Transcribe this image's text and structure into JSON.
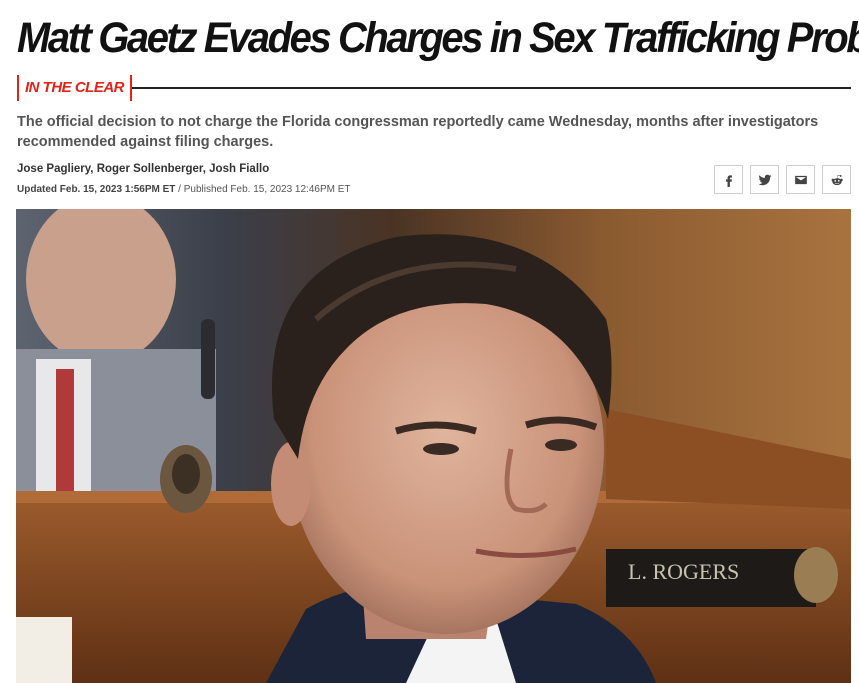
{
  "article": {
    "headline": "Matt Gaetz Evades Charges in Sex Trafficking Probe",
    "rubric": "IN THE CLEAR",
    "dek": "The official decision to not charge the Florida congressman reportedly came Wednesday, months after investigators recommended against filing charges.",
    "authors": "Jose Pagliery, Roger Sollenberger, Josh Fiallo",
    "updated": "Updated Feb. 15, 2023 1:56PM ET",
    "published_sep": " / ",
    "published": "Published Feb. 15, 2023 12:46PM ET"
  },
  "share": {
    "icons": [
      "facebook-icon",
      "twitter-icon",
      "email-icon",
      "reddit-icon"
    ]
  },
  "photo": {
    "nameplate": "L. ROGERS"
  },
  "colors": {
    "accent": "#e2231a",
    "text": "#111111",
    "muted": "#555555"
  }
}
